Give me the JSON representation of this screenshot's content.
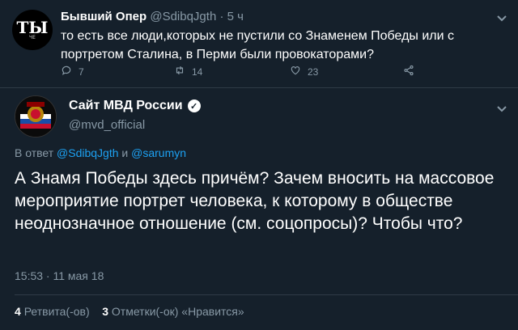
{
  "colors": {
    "background": "#15202b",
    "muted": "#8899a6",
    "link": "#1da1f2",
    "text": "#ffffff"
  },
  "tweet1": {
    "name": "Бывший Опер",
    "handle": "@SdibqJgth",
    "separator": "·",
    "age": "5 ч",
    "text": "то есть все люди,которых не пустили со Знаменем Победы или с портретом Сталина, в Перми были провокаторами?",
    "avatar_text": "ТЫ",
    "avatar_small": "ЧЕ",
    "counts": {
      "replies": "7",
      "retweets": "14",
      "likes": "23"
    }
  },
  "tweet2": {
    "name": "Сайт МВД России",
    "handle": "@mvd_official",
    "reply_prefix": "В ответ",
    "reply_user1": "@SdibqJgth",
    "reply_and": "и",
    "reply_user2": "@sarumyn",
    "text": "А Знамя Победы здесь причём? Зачем вносить на массовое мероприятие портрет человека, к которому в обществе неоднозначное отношение (см. соцопросы)? Чтобы что?",
    "timestamp": "15:53 · 11 мая 18",
    "retweets_count": "4",
    "retweets_label": "Ретвита(-ов)",
    "likes_count": "3",
    "likes_label": "Отметки(-ок) «Нравится»"
  },
  "icons": [
    "reply-icon",
    "retweet-icon",
    "like-icon",
    "share-icon",
    "chevron-down-icon",
    "verified-icon"
  ]
}
